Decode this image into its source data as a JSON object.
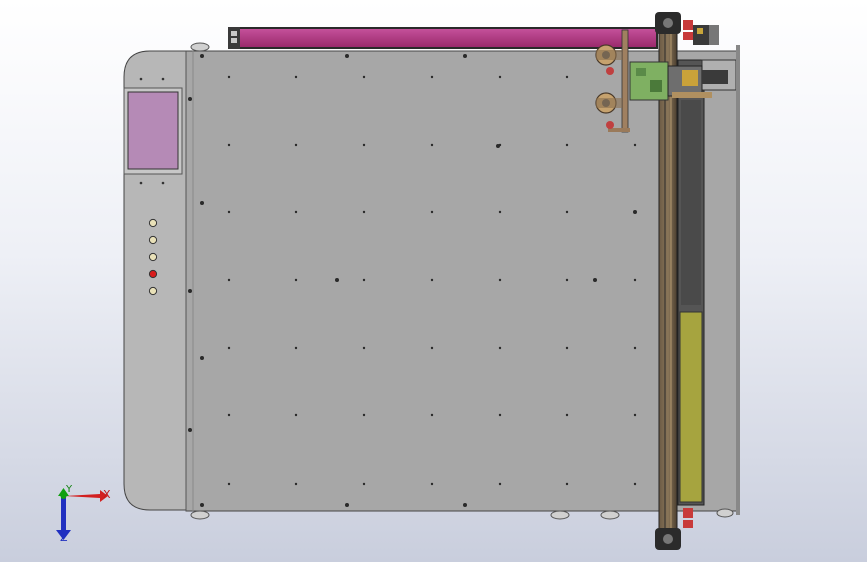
{
  "axes": {
    "x_label": "X",
    "y_label": "Y",
    "z_label": "Z"
  },
  "colors": {
    "background_top": "#ffffff",
    "background_bottom": "#c9cedd",
    "table_surface": "#a7a7a7",
    "side_cabinet": "#b7b7b7",
    "top_rail": "#b2347f",
    "screen": "#b58ab6",
    "gantry_dark": "#4a4a4a",
    "yellow_track": "#a6a43f",
    "green_board": "#7fb062",
    "red_indicator": "#d81b1b",
    "axis_x": "#d22020",
    "axis_y": "#10a010",
    "axis_z": "#2030c0"
  },
  "indicators": [
    {
      "name": "indicator-light",
      "state": "off"
    },
    {
      "name": "indicator-light",
      "state": "off"
    },
    {
      "name": "indicator-light",
      "state": "off"
    },
    {
      "name": "indicator-light",
      "state": "on"
    },
    {
      "name": "indicator-light",
      "state": "off"
    }
  ]
}
